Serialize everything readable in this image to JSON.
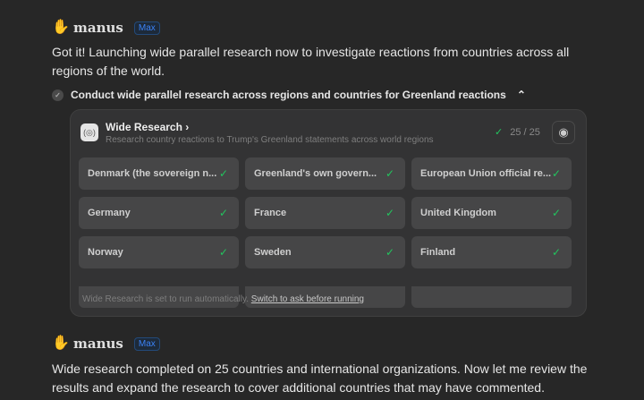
{
  "messages": [
    {
      "brand": "manus",
      "badge": "Max",
      "text": "Got it! Launching wide parallel research now to investigate reactions from countries across all regions of the world."
    },
    {
      "brand": "manus",
      "badge": "Max",
      "text": "Wide research completed on 25 countries and international organizations. Now let me review the results and expand the research to cover additional countries that may have commented."
    }
  ],
  "step": {
    "label": "Conduct wide parallel research across regions and countries for Greenland reactions",
    "chevron": "^"
  },
  "card": {
    "title": "Wide Research",
    "subtitle": "Research country reactions to Trump's Greenland statements across world regions",
    "count": "25 / 25",
    "items": [
      "Denmark (the sovereign n...",
      "Greenland's own govern...",
      "European Union official re...",
      "Germany",
      "France",
      "United Kingdom",
      "Norway",
      "Sweden",
      "Finland"
    ],
    "footer": "Wide Research is set to run automatically.",
    "footer_link": "Switch to ask before running"
  },
  "colors": {
    "accent": "#3b82f6",
    "success": "#22c55e"
  }
}
